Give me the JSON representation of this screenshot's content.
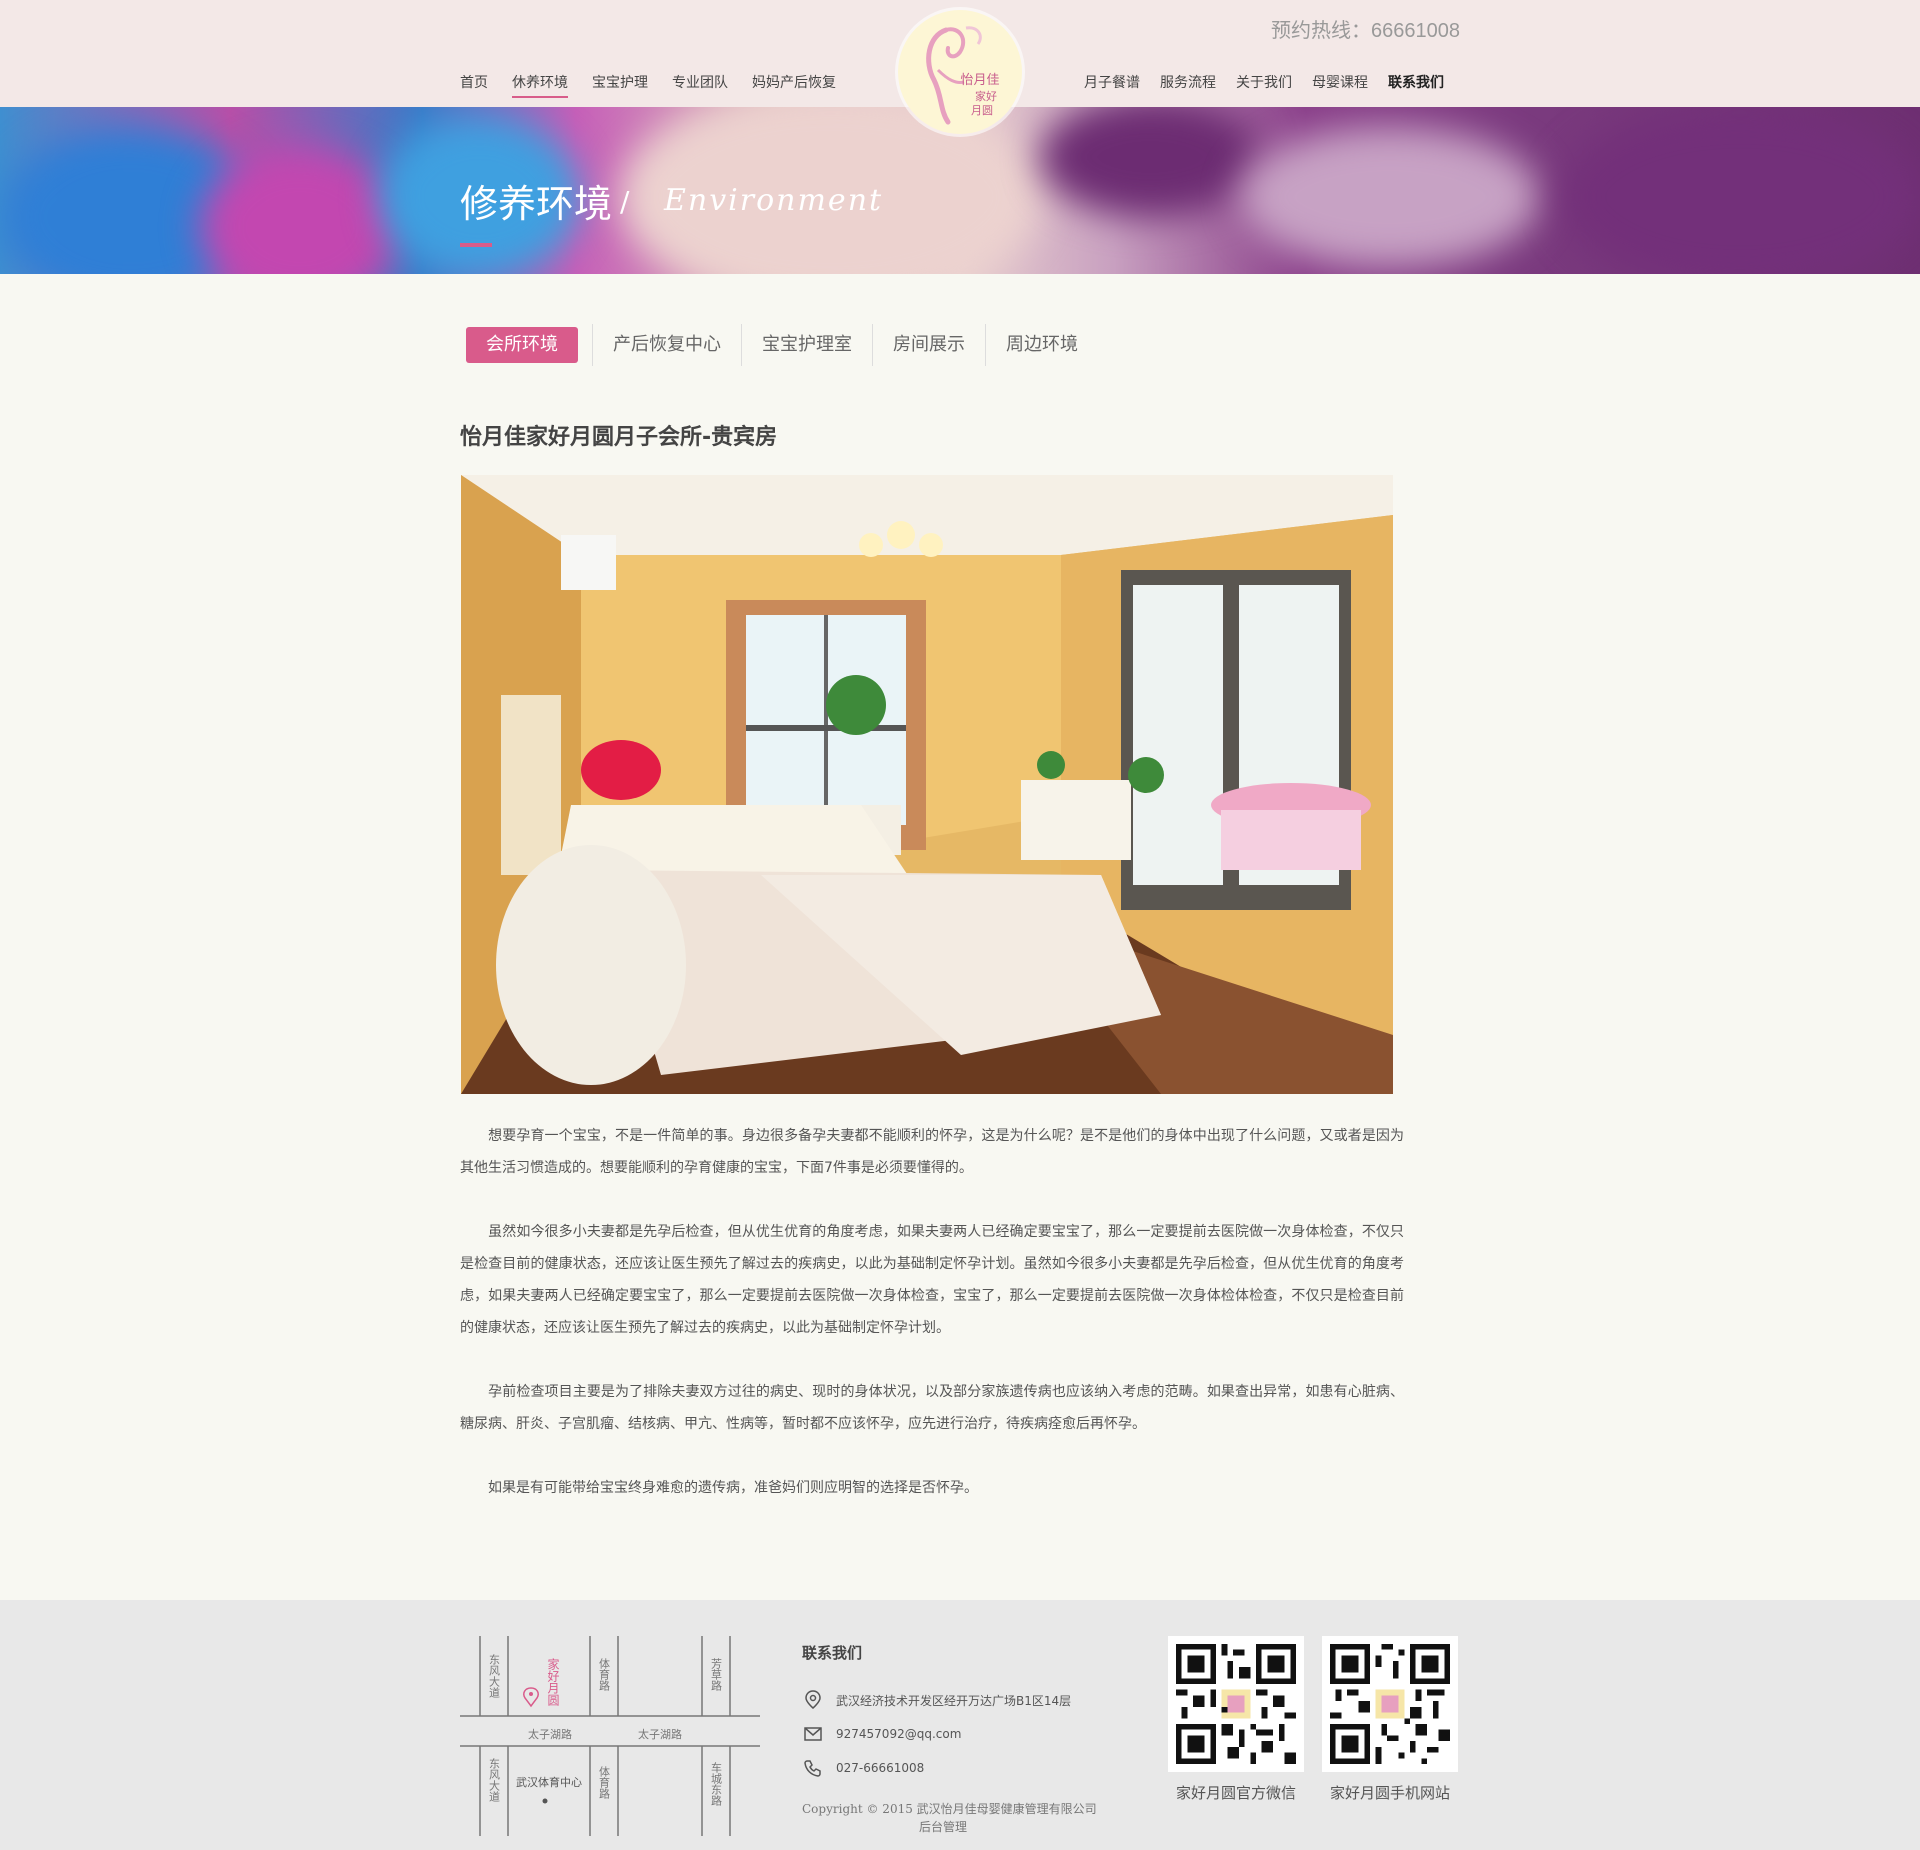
{
  "header": {
    "hotline": "预约热线：66661008",
    "nav_left": [
      "首页",
      "休养环境",
      "宝宝护理",
      "专业团队",
      "妈妈产后恢复"
    ],
    "nav_right": [
      "月子餐谱",
      "服务流程",
      "关于我们",
      "母婴课程",
      "联系我们"
    ],
    "logo_text": [
      "怡月佳",
      "家好",
      "月圆"
    ]
  },
  "banner": {
    "title": "修养环境",
    "slash": "/",
    "subtitle": "Environment"
  },
  "tabs": [
    "会所环境",
    "产后恢复中心",
    "宝宝护理室",
    "房间展示",
    "周边环境"
  ],
  "article": {
    "title": "怡月佳家好月圆月子会所-贵宾房",
    "paragraphs": [
      "　　想要孕育一个宝宝，不是一件简单的事。身边很多备孕夫妻都不能顺利的怀孕，这是为什么呢？是不是他们的身体中出现了什么问题，又或者是因为其他生活习惯造成的。想要能顺利的孕育健康的宝宝，下面7件事是必须要懂得的。",
      "　　虽然如今很多小夫妻都是先孕后检查，但从优生优育的角度考虑，如果夫妻两人已经确定要宝宝了，那么一定要提前去医院做一次身体检查，不仅只是检查目前的健康状态，还应该让医生预先了解过去的疾病史，以此为基础制定怀孕计划。虽然如今很多小夫妻都是先孕后检查，但从优生优育的角度考虑，如果夫妻两人已经确定要宝宝了，那么一定要提前去医院做一次身体检查，宝宝了，那么一定要提前去医院做一次身体检体检查，不仅只是检查目前的健康状态，还应该让医生预先了解过去的疾病史，以此为基础制定怀孕计划。",
      "　　孕前检查项目主要是为了排除夫妻双方过往的病史、现时的身体状况，以及部分家族遗传病也应该纳入考虑的范畴。如果查出异常，如患有心脏病、糖尿病、肝炎、子宫肌瘤、结核病、甲亢、性病等，暂时都不应该怀孕，应先进行治疗，待疾病痊愈后再怀孕。",
      "　　如果是有可能带给宝宝终身难愈的遗传病，准爸妈们则应明智的选择是否怀孕。"
    ]
  },
  "footer": {
    "map": {
      "roads": [
        "东风大道",
        "体育路",
        "芳草路",
        "太子湖路",
        "太子湖路",
        "东风大道",
        "体育路",
        "车城东路"
      ],
      "marker": "家好月圆",
      "landmark": "武汉体育中心"
    },
    "contact_title": "联系我们",
    "address": "武汉经济技术开发区经开万达广场B1区14层",
    "email": "927457092@qq.com",
    "phone": "027-66661008",
    "copyright": "Copyright © 2015    武汉怡月佳母婴健康管理有限公司",
    "admin": "后台管理",
    "qr1_caption": "家好月圆官方微信",
    "qr2_caption": "家好月圆手机网站"
  },
  "colors": {
    "accent": "#d95b8b",
    "header_bg": "#f3e8e7",
    "page_bg": "#f8f8f2",
    "footer_bg": "#e8e8e8"
  }
}
